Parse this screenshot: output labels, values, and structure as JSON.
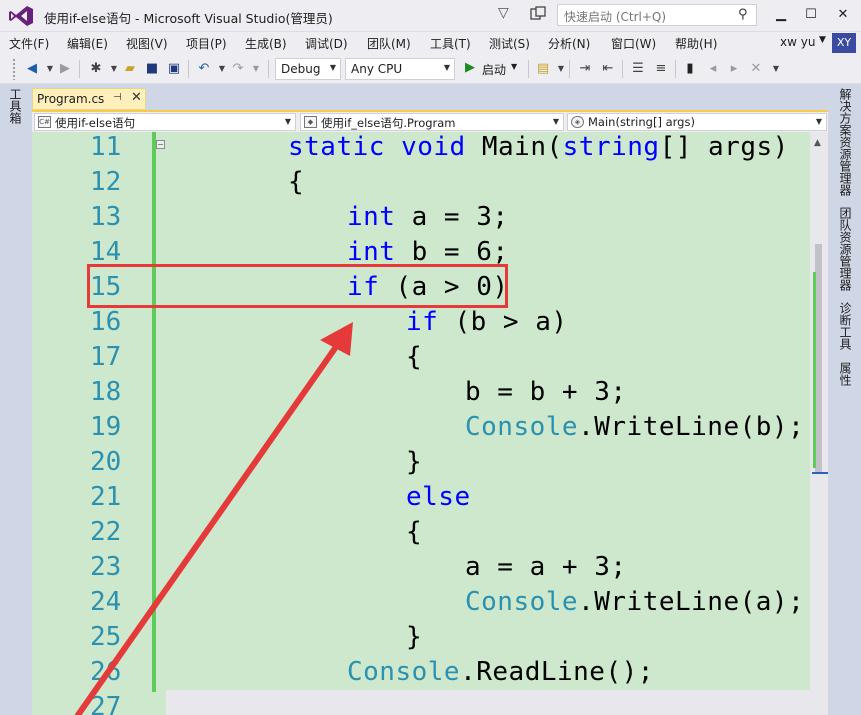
{
  "window": {
    "title": "使用if-else语句 - Microsoft Visual Studio(管理员)",
    "quick_launch_placeholder": "快速启动 (Ctrl+Q)"
  },
  "menu": {
    "items": [
      "文件(F)",
      "编辑(E)",
      "视图(V)",
      "项目(P)",
      "生成(B)",
      "调试(D)",
      "团队(M)",
      "工具(T)",
      "测试(S)",
      "分析(N)",
      "窗口(W)",
      "帮助(H)"
    ],
    "user_name": "xw yu",
    "user_initials": "XY"
  },
  "toolbar": {
    "config": "Debug",
    "platform": "Any CPU",
    "start_label": "启动"
  },
  "side_tabs": {
    "left": "工具箱",
    "right": [
      "解决方案资源管理器",
      "团队资源管理器",
      "诊断工具",
      "属性"
    ]
  },
  "document_tab": {
    "label": "Program.cs",
    "pin": "⊣",
    "close": "✕"
  },
  "navbar": {
    "project": "使用if-else语句",
    "class": "使用if_else语句.Program",
    "member": "Main(string[] args)"
  },
  "code": {
    "line_numbers": [
      "11",
      "12",
      "13",
      "14",
      "15",
      "16",
      "17",
      "18",
      "19",
      "20",
      "21",
      "22",
      "23",
      "24",
      "25",
      "26",
      "27"
    ],
    "l11": {
      "kw1": "static",
      "kw2": "void",
      "rest": "Main(",
      "kw3": "string",
      "tail": "[] args)"
    },
    "l12": "{",
    "l13": {
      "kw": "int",
      "rest": " a = 3;"
    },
    "l14": {
      "kw": "int",
      "rest": " b = 6;"
    },
    "l15": {
      "kw": "if",
      "rest": " (a > 0)"
    },
    "l16": {
      "kw": "if",
      "rest": " (b > a)"
    },
    "l17": "{",
    "l18": "b = b + 3;",
    "l19": {
      "ty": "Console",
      "rest": ".WriteLine(b);"
    },
    "l20": "}",
    "l21": {
      "kw": "else"
    },
    "l22": "{",
    "l23": "a = a + 3;",
    "l24": {
      "ty": "Console",
      "rest": ".WriteLine(a);"
    },
    "l25": "}",
    "l26": {
      "ty": "Console",
      "rest": ".ReadLine();"
    },
    "l27": "}"
  },
  "colors": {
    "editor_bg": "#cde8cc",
    "keyword": "#0000ff",
    "type": "#2b91af",
    "annotation": "#e53a3a"
  }
}
